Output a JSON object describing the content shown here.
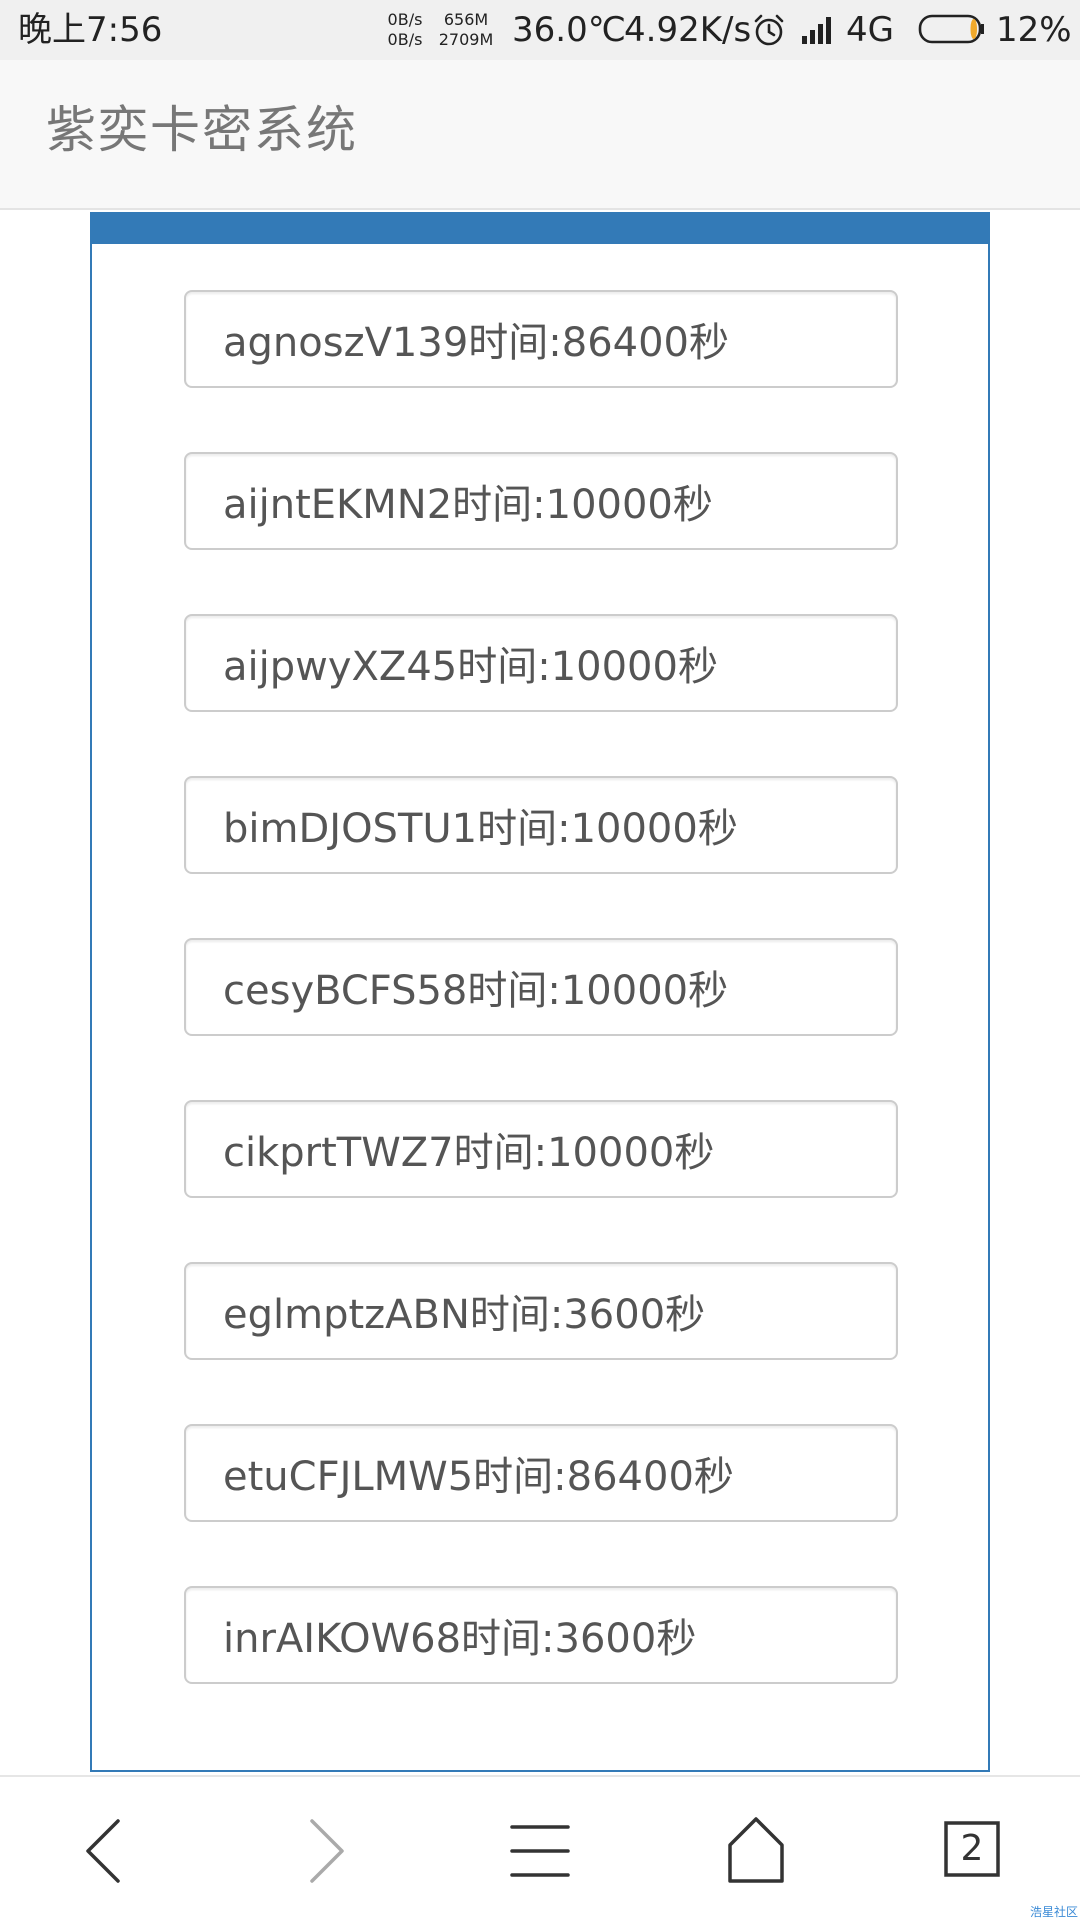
{
  "status_bar": {
    "time": "晚上7:56",
    "upload_speed": "0B/s",
    "download_speed": "0B/s",
    "memory_used": "656M",
    "memory_total": "2709M",
    "temperature": "36.0℃",
    "network_speed": "4.92K/s",
    "network_type": "4G",
    "battery_percent": "12%",
    "battery_level": 0.12,
    "icons": [
      "alarm-icon",
      "signal-icon",
      "battery-icon"
    ]
  },
  "header": {
    "title": "紫奕卡密系统"
  },
  "cards": [
    {
      "text": "agnoszV139时间:86400秒"
    },
    {
      "text": "aijntEKMN2时间:10000秒"
    },
    {
      "text": "aijpwyXZ45时间:10000秒"
    },
    {
      "text": "bimDJOSTU1时间:10000秒"
    },
    {
      "text": "cesyBCFS58时间:10000秒"
    },
    {
      "text": "cikprtTWZ7时间:10000秒"
    },
    {
      "text": "eglmptzABN时间:3600秒"
    },
    {
      "text": "etuCFJLMW5时间:86400秒"
    },
    {
      "text": "inrAIKOW68时间:3600秒"
    }
  ],
  "bottom_nav": {
    "icons": [
      "back-icon",
      "forward-icon",
      "menu-icon",
      "home-icon",
      "tabs-icon"
    ],
    "tabs_count": "2"
  },
  "watermark": "浩星社区",
  "colors": {
    "panel_accent": "#337ab7",
    "text": "#555555",
    "header_bg": "#f8f8f8",
    "status_bg": "#f0f0f0",
    "battery_fill": "#f0a92b"
  }
}
